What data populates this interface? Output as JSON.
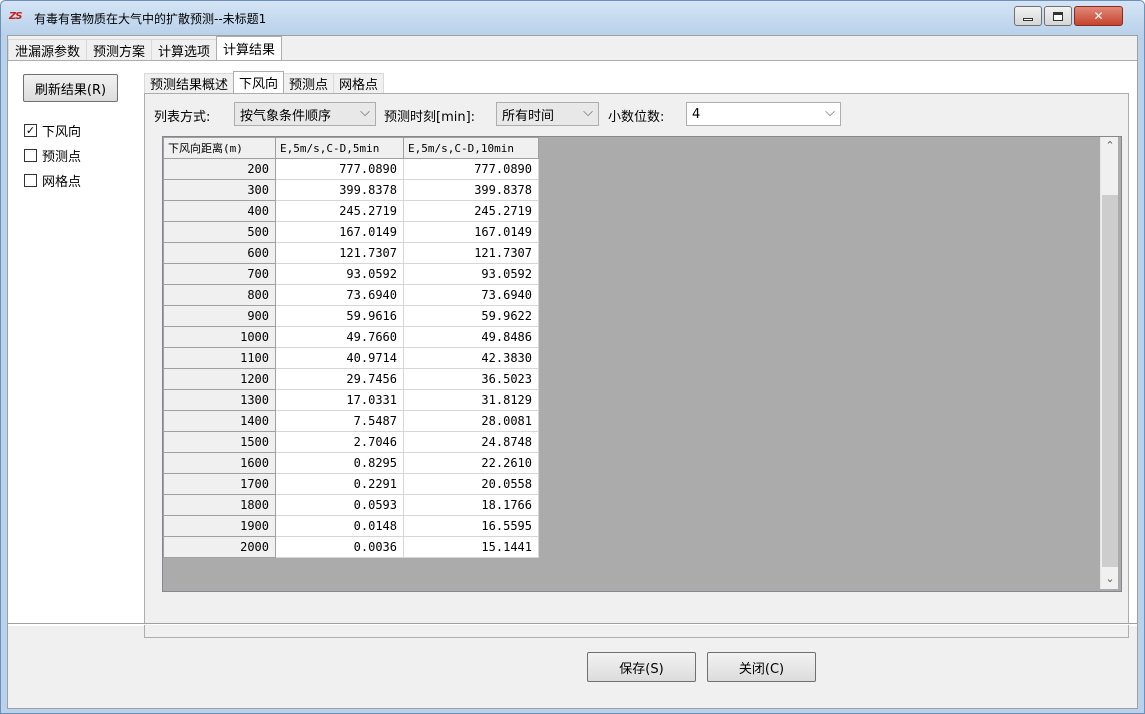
{
  "window": {
    "title": "有毒有害物质在大气中的扩散预测--未标题1",
    "icon_text": "ZS"
  },
  "top_tabs": [
    {
      "label": "泄漏源参数",
      "active": false
    },
    {
      "label": "预测方案",
      "active": false
    },
    {
      "label": "计算选项",
      "active": false
    },
    {
      "label": "计算结果",
      "active": true
    }
  ],
  "left": {
    "refresh_label": "刷新结果(R)",
    "checkboxes": [
      {
        "label": "下风向",
        "checked": true
      },
      {
        "label": "预测点",
        "checked": false
      },
      {
        "label": "网格点",
        "checked": false
      }
    ]
  },
  "sub_tabs": [
    {
      "label": "预测结果概述",
      "active": false
    },
    {
      "label": "下风向",
      "active": true
    },
    {
      "label": "预测点",
      "active": false
    },
    {
      "label": "网格点",
      "active": false
    }
  ],
  "options": {
    "list_mode_label": "列表方式:",
    "list_mode_value": "按气象条件顺序",
    "time_label": "预测时刻[min]:",
    "time_value": "所有时间",
    "decimals_label": "小数位数:",
    "decimals_value": "4"
  },
  "table": {
    "columns": [
      "下风向距离(m)",
      "E,5m/s,C-D,5min",
      "E,5m/s,C-D,10min"
    ],
    "rows": [
      [
        "200",
        "777.0890",
        "777.0890"
      ],
      [
        "300",
        "399.8378",
        "399.8378"
      ],
      [
        "400",
        "245.2719",
        "245.2719"
      ],
      [
        "500",
        "167.0149",
        "167.0149"
      ],
      [
        "600",
        "121.7307",
        "121.7307"
      ],
      [
        "700",
        "93.0592",
        "93.0592"
      ],
      [
        "800",
        "73.6940",
        "73.6940"
      ],
      [
        "900",
        "59.9616",
        "59.9622"
      ],
      [
        "1000",
        "49.7660",
        "49.8486"
      ],
      [
        "1100",
        "40.9714",
        "42.3830"
      ],
      [
        "1200",
        "29.7456",
        "36.5023"
      ],
      [
        "1300",
        "17.0331",
        "31.8129"
      ],
      [
        "1400",
        "7.5487",
        "28.0081"
      ],
      [
        "1500",
        "2.7046",
        "24.8748"
      ],
      [
        "1600",
        "0.8295",
        "22.2610"
      ],
      [
        "1700",
        "0.2291",
        "20.0558"
      ],
      [
        "1800",
        "0.0593",
        "18.1766"
      ],
      [
        "1900",
        "0.0148",
        "16.5595"
      ],
      [
        "2000",
        "0.0036",
        "15.1441"
      ]
    ]
  },
  "buttons": {
    "save": "保存(S)",
    "close": "关闭(C)"
  }
}
